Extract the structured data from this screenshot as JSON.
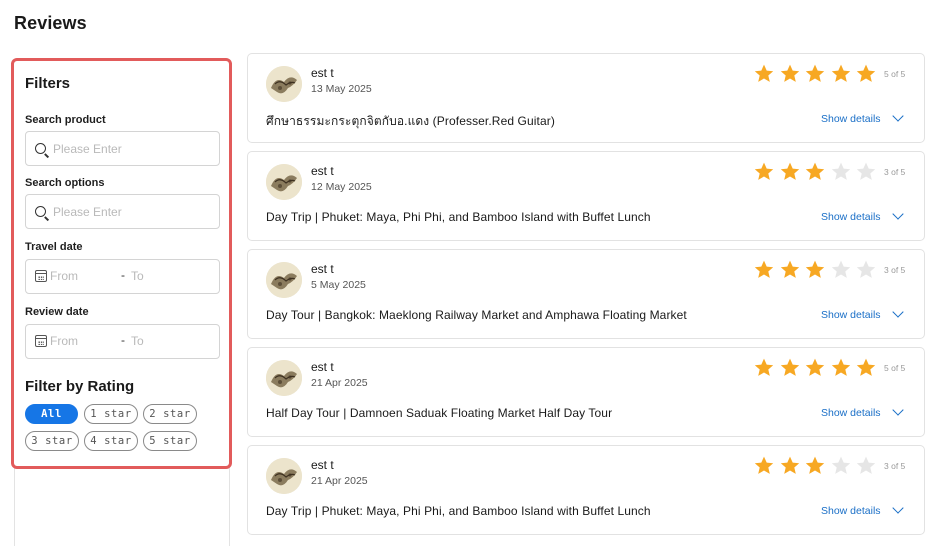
{
  "page": {
    "title": "Reviews"
  },
  "filters": {
    "title": "Filters",
    "search_product": {
      "label": "Search product",
      "placeholder": "Please Enter"
    },
    "search_options": {
      "label": "Search options",
      "placeholder": "Please Enter"
    },
    "travel_date": {
      "label": "Travel date",
      "from": "From",
      "separator": "-",
      "to": "To"
    },
    "review_date": {
      "label": "Review date",
      "from": "From",
      "separator": "-",
      "to": "To"
    },
    "rating": {
      "title": "Filter by Rating",
      "chips": [
        "All",
        "1 star",
        "2 star",
        "3 star",
        "4 star",
        "5 star"
      ],
      "selected": "All"
    }
  },
  "reviews": [
    {
      "reviewer": "est  t",
      "date": "13 May 2025",
      "rating": 5,
      "rating_text": "5 of 5",
      "product": "ศึกษาธรรมะกระตุกจิตกับอ.แดง (Professer.Red Guitar)",
      "details_label": "Show details"
    },
    {
      "reviewer": "est  t",
      "date": "12 May 2025",
      "rating": 3,
      "rating_text": "3 of 5",
      "product": "Day Trip | Phuket: Maya, Phi Phi, and Bamboo Island with Buffet Lunch",
      "details_label": "Show details"
    },
    {
      "reviewer": "est  t",
      "date": "5 May 2025",
      "rating": 3,
      "rating_text": "3 of 5",
      "product": "Day Tour | Bangkok: Maeklong Railway Market and Amphawa Floating Market",
      "details_label": "Show details"
    },
    {
      "reviewer": "est  t",
      "date": "21 Apr 2025",
      "rating": 5,
      "rating_text": "5 of 5",
      "product": "Half Day Tour | Damnoen Saduak Floating Market Half Day Tour",
      "details_label": "Show details"
    },
    {
      "reviewer": "est  t",
      "date": "21 Apr 2025",
      "rating": 3,
      "rating_text": "3 of 5",
      "product": "Day Trip | Phuket: Maya, Phi Phi, and Bamboo Island with Buffet Lunch",
      "details_label": "Show details"
    }
  ],
  "colors": {
    "star_filled": "#f7a823",
    "star_empty": "#e6e6e6",
    "accent": "#1676e6",
    "filter_border": "#e25b5b",
    "link": "#1a6fc7"
  },
  "icons": {
    "search": "search-icon",
    "calendar": "calendar-icon",
    "star": "star-icon",
    "chevron": "chevron-down-icon",
    "avatar": "avatar"
  }
}
